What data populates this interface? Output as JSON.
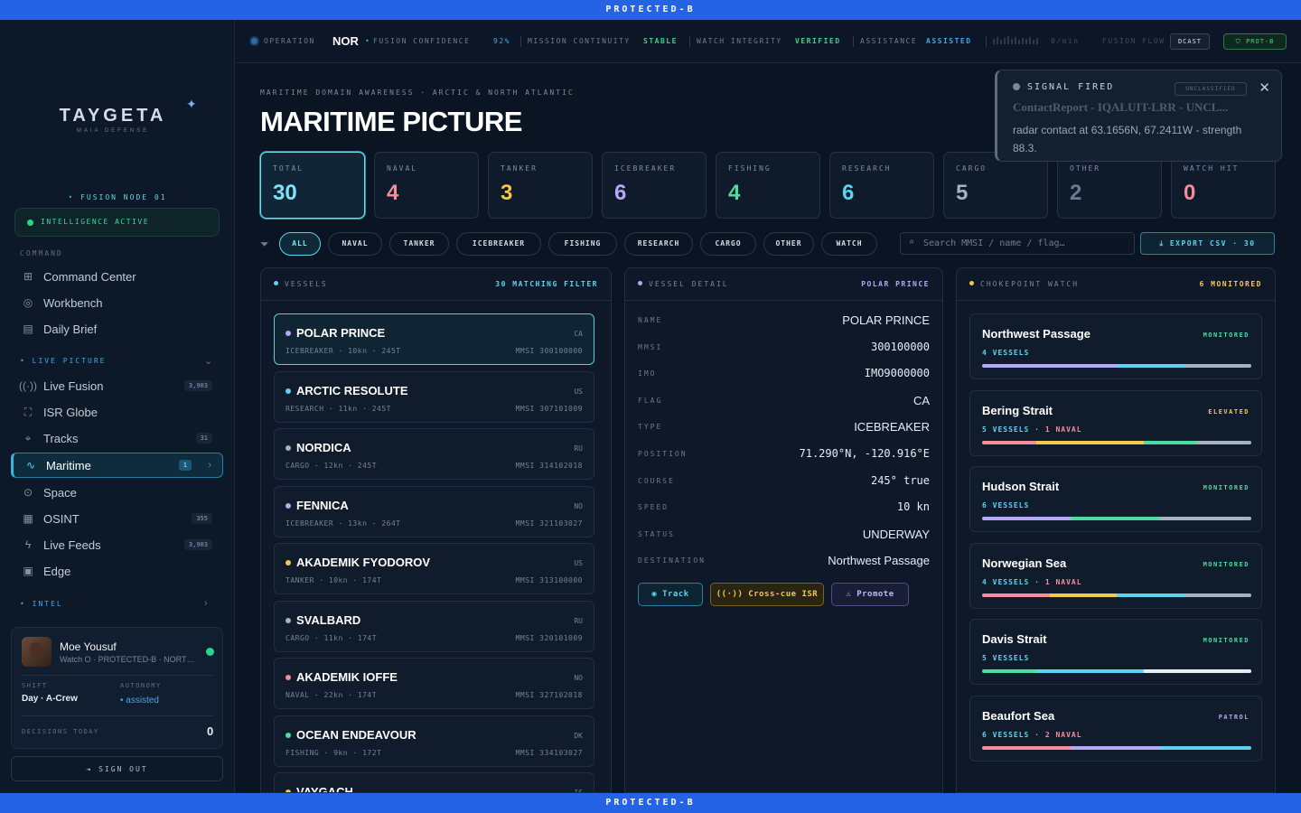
{
  "banner": "PROTECTED-B",
  "brand": {
    "name": "TAYGETA",
    "sub": "MAIA DEFENSE"
  },
  "sidebar": {
    "fusion_node": "FUSION NODE 01",
    "intel_status": "INTELLIGENCE ACTIVE",
    "section_command": "COMMAND",
    "command_items": [
      {
        "label": "Command Center",
        "icon": "grid-icon"
      },
      {
        "label": "Workbench",
        "icon": "globe-icon"
      },
      {
        "label": "Daily Brief",
        "icon": "document-icon"
      }
    ],
    "section_live": "LIVE PICTURE",
    "live_items": [
      {
        "label": "Live Fusion",
        "icon": "broadcast-icon",
        "count": "3,903"
      },
      {
        "label": "ISR Globe",
        "icon": "network-icon",
        "count": ""
      },
      {
        "label": "Tracks",
        "icon": "pin-icon",
        "count": "31"
      },
      {
        "label": "Maritime",
        "icon": "pulse-icon",
        "count": "1"
      },
      {
        "label": "Space",
        "icon": "satellite-icon",
        "count": ""
      },
      {
        "label": "OSINT",
        "icon": "newspaper-icon",
        "count": "355"
      },
      {
        "label": "Live Feeds",
        "icon": "bolt-icon",
        "count": "3,903"
      },
      {
        "label": "Edge",
        "icon": "chip-icon",
        "count": ""
      }
    ],
    "section_intel": "INTEL",
    "user": {
      "name": "Moe Yousuf",
      "role": "Watch O · PROTECTED-B · NORTHCOM",
      "shift_label": "SHIFT",
      "shift": "Day · A-Crew",
      "autonomy_label": "AUTONOMY",
      "autonomy": "assisted",
      "decisions_label": "DECISIONS TODAY",
      "decisions": "0"
    },
    "sign_out": "SIGN OUT"
  },
  "topbar": {
    "operation_label": "OPERATION",
    "operation": "NOR",
    "fusion_label": "FUSION CONFIDENCE",
    "fusion_value": "92%",
    "continuity_label": "MISSION CONTINUITY",
    "continuity_value": "STABLE",
    "integrity_label": "WATCH INTEGRITY",
    "integrity_value": "VERIFIED",
    "assistance_label": "ASSISTANCE",
    "assistance_value": "ASSISTED",
    "flow_rate": "0/min",
    "flow_label": "FUSION FLOW",
    "broadcast": "DCAST",
    "classification": "PROT-B"
  },
  "page": {
    "breadcrumb": "MARITIME DOMAIN AWARENESS · ARCTIC & NORTH ATLANTIC",
    "title": "MARITIME PICTURE"
  },
  "stats": [
    {
      "label": "TOTAL",
      "value": "30",
      "color": "#7ee4f5"
    },
    {
      "label": "NAVAL",
      "value": "4",
      "color": "#f58d9a"
    },
    {
      "label": "TANKER",
      "value": "3",
      "color": "#f4c84b"
    },
    {
      "label": "ICEBREAKER",
      "value": "6",
      "color": "#b5a8f5"
    },
    {
      "label": "FISHING",
      "value": "4",
      "color": "#4fdca0"
    },
    {
      "label": "RESEARCH",
      "value": "6",
      "color": "#5ed3ef"
    },
    {
      "label": "CARGO",
      "value": "5",
      "color": "#a6b2c2"
    },
    {
      "label": "OTHER",
      "value": "2",
      "color": "#6b7a8d"
    },
    {
      "label": "WATCH HIT",
      "value": "0",
      "color": "#f58d9a"
    }
  ],
  "filters": [
    "ALL",
    "NAVAL",
    "TANKER",
    "ICEBREAKER",
    "FISHING",
    "RESEARCH",
    "CARGO",
    "OTHER",
    "WATCH"
  ],
  "search": {
    "placeholder": "Search MMSI / name / flag…"
  },
  "export": "EXPORT CSV · 30",
  "vessels_panel": {
    "title": "VESSELS",
    "count": "30 MATCHING FILTER",
    "items": [
      {
        "name": "POLAR PRINCE",
        "flag": "CA",
        "meta": "ICEBREAKER · 10kn · 245T",
        "mmsi": "MMSI 300100000",
        "color": "#b5a8f5"
      },
      {
        "name": "ARCTIC RESOLUTE",
        "flag": "US",
        "meta": "RESEARCH · 11kn · 245T",
        "mmsi": "MMSI 307101009",
        "color": "#5ed3ef"
      },
      {
        "name": "NORDICA",
        "flag": "RU",
        "meta": "CARGO · 12kn · 245T",
        "mmsi": "MMSI 314102018",
        "color": "#a6b2c2"
      },
      {
        "name": "FENNICA",
        "flag": "NO",
        "meta": "ICEBREAKER · 13kn · 264T",
        "mmsi": "MMSI 321103027",
        "color": "#b5a8f5"
      },
      {
        "name": "AKADEMIK FYODOROV",
        "flag": "US",
        "meta": "TANKER · 10kn · 174T",
        "mmsi": "MMSI 313100000",
        "color": "#f4c84b"
      },
      {
        "name": "SVALBARD",
        "flag": "RU",
        "meta": "CARGO · 11kn · 174T",
        "mmsi": "MMSI 320101009",
        "color": "#a6b2c2"
      },
      {
        "name": "AKADEMIK IOFFE",
        "flag": "NO",
        "meta": "NAVAL · 22kn · 174T",
        "mmsi": "MMSI 327102018",
        "color": "#f58d9a"
      },
      {
        "name": "OCEAN ENDEAVOUR",
        "flag": "DK",
        "meta": "FISHING · 9kn · 172T",
        "mmsi": "MMSI 334103027",
        "color": "#4fdca0"
      },
      {
        "name": "VAYGACH",
        "flag": "IS",
        "meta": "",
        "mmsi": "",
        "color": "#f4c84b"
      }
    ]
  },
  "detail_panel": {
    "title": "VESSEL DETAIL",
    "selected": "POLAR PRINCE",
    "rows": [
      {
        "key": "NAME",
        "value": "POLAR PRINCE",
        "mono": false
      },
      {
        "key": "MMSI",
        "value": "300100000",
        "mono": true
      },
      {
        "key": "IMO",
        "value": "IMO9000000",
        "mono": true
      },
      {
        "key": "FLAG",
        "value": "CA",
        "mono": false
      },
      {
        "key": "TYPE",
        "value": "ICEBREAKER",
        "mono": false
      },
      {
        "key": "POSITION",
        "value": "71.290°N, -120.916°E",
        "mono": true
      },
      {
        "key": "COURSE",
        "value": "245° true",
        "mono": true
      },
      {
        "key": "SPEED",
        "value": "10 kn",
        "mono": true
      },
      {
        "key": "STATUS",
        "value": "UNDERWAY",
        "mono": false
      },
      {
        "key": "DESTINATION",
        "value": "Northwest Passage",
        "mono": false
      }
    ],
    "actions": {
      "track": "Track",
      "cross_cue": "Cross-cue ISR",
      "promote": "Promote"
    }
  },
  "chokepoint_panel": {
    "title": "CHOKEPOINT WATCH",
    "count": "6 MONITORED",
    "items": [
      {
        "name": "Northwest Passage",
        "status": "MONITORED",
        "status_color": "#4fdca0",
        "vessels": "4 VESSELS",
        "naval": "",
        "segments": [
          {
            "pct": 50,
            "color": "#b5a8f5"
          },
          {
            "pct": 25,
            "color": "#5ed3ef"
          },
          {
            "pct": 25,
            "color": "#a6b2c2"
          }
        ]
      },
      {
        "name": "Bering Strait",
        "status": "ELEVATED",
        "status_color": "#f4c84b",
        "vessels": "5 VESSELS",
        "naval": "1 NAVAL",
        "segments": [
          {
            "pct": 20,
            "color": "#f58d9a"
          },
          {
            "pct": 40,
            "color": "#f4c84b"
          },
          {
            "pct": 20,
            "color": "#4fdca0"
          },
          {
            "pct": 20,
            "color": "#a6b2c2"
          }
        ]
      },
      {
        "name": "Hudson Strait",
        "status": "MONITORED",
        "status_color": "#4fdca0",
        "vessels": "6 VESSELS",
        "naval": "",
        "segments": [
          {
            "pct": 33,
            "color": "#b5a8f5"
          },
          {
            "pct": 33,
            "color": "#4fdca0"
          },
          {
            "pct": 34,
            "color": "#a6b2c2"
          }
        ]
      },
      {
        "name": "Norwegian Sea",
        "status": "MONITORED",
        "status_color": "#4fdca0",
        "vessels": "4 VESSELS",
        "naval": "1 NAVAL",
        "segments": [
          {
            "pct": 25,
            "color": "#f58d9a"
          },
          {
            "pct": 25,
            "color": "#f4c84b"
          },
          {
            "pct": 25,
            "color": "#5ed3ef"
          },
          {
            "pct": 25,
            "color": "#a6b2c2"
          }
        ]
      },
      {
        "name": "Davis Strait",
        "status": "MONITORED",
        "status_color": "#4fdca0",
        "vessels": "5 VESSELS",
        "naval": "",
        "segments": [
          {
            "pct": 20,
            "color": "#4fdca0"
          },
          {
            "pct": 40,
            "color": "#5ed3ef"
          },
          {
            "pct": 40,
            "color": "#e6edf5"
          }
        ]
      },
      {
        "name": "Beaufort Sea",
        "status": "PATROL",
        "status_color": "#b5a8f5",
        "vessels": "6 VESSELS",
        "naval": "2 NAVAL",
        "segments": [
          {
            "pct": 33,
            "color": "#f58d9a"
          },
          {
            "pct": 33,
            "color": "#b5a8f5"
          },
          {
            "pct": 34,
            "color": "#5ed3ef"
          }
        ]
      }
    ]
  },
  "toast": {
    "title": "SIGNAL FIRED",
    "classification": "UNCLASSIFIED",
    "subtitle": "ContactReport - IQALUIT-LRR - UNCL...",
    "body": "radar contact at 63.1656N, 67.2411W - strength 88.3."
  }
}
